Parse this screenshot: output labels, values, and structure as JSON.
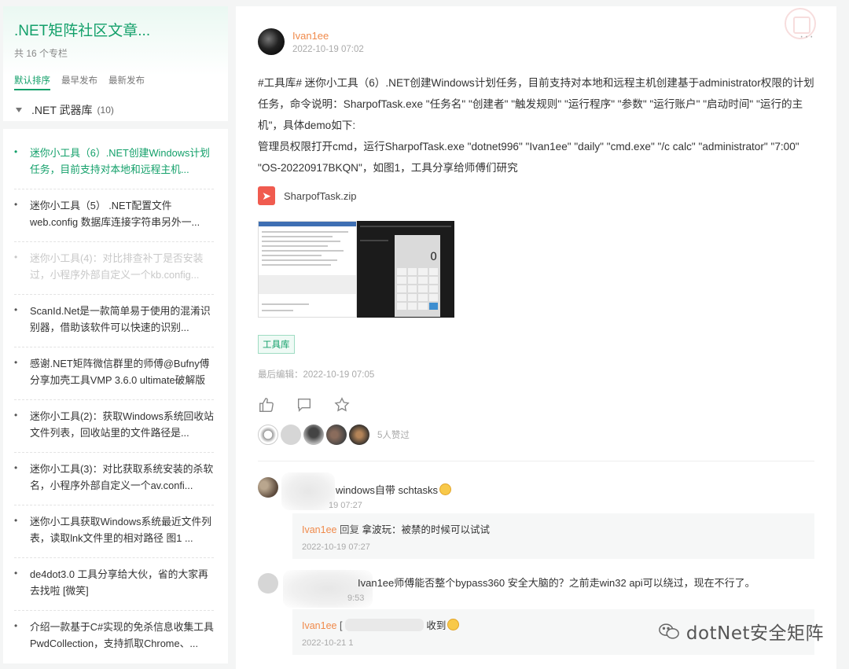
{
  "sidebar": {
    "title": ".NET矩阵社区文章...",
    "subtitle": "共 16 个专栏",
    "sort_tabs": [
      "默认排序",
      "最早发布",
      "最新发布"
    ],
    "category": {
      "label": ".NET 武器库",
      "count": "(10)"
    },
    "articles": [
      {
        "text": "迷你小工具（6）.NET创建Windows计划任务，目前支持对本地和远程主机...",
        "state": "active"
      },
      {
        "text": "迷你小工具（5） .NET配置文件web.config 数据库连接字符串另外一...",
        "state": "normal"
      },
      {
        "text": "迷你小工具(4)：对比排查补丁是否安装过，小程序外部自定义一个kb.config...",
        "state": "faded"
      },
      {
        "text": "ScanId.Net是一款简单易于使用的混淆识别器，借助该软件可以快速的识别...",
        "state": "normal"
      },
      {
        "text": "感谢.NET矩阵微信群里的师傅@Bufny傅分享加壳工具VMP 3.6.0 ultimate破解版",
        "state": "normal"
      },
      {
        "text": "迷你小工具(2)：获取Windows系统回收站文件列表，回收站里的文件路径是...",
        "state": "normal"
      },
      {
        "text": "迷你小工具(3)：对比获取系统安装的杀软名，小程序外部自定义一个av.confi...",
        "state": "normal"
      },
      {
        "text": "迷你小工具获取Windows系统最近文件列表，读取lnk文件里的相对路径 图1 ...",
        "state": "normal"
      },
      {
        "text": "de4dot3.0 工具分享给大伙，省的大家再去找啦 [微笑]",
        "state": "normal"
      },
      {
        "text": "介绍一款基于C#实现的免杀信息收集工具PwdCollection，支持抓取Chrome、...",
        "state": "normal"
      }
    ]
  },
  "post": {
    "author": "Ivan1ee",
    "time": "2022-10-19 07:02",
    "body_line1": "#工具库# 迷你小工具（6）.NET创建Windows计划任务，目前支持对本地和远程主机创建基于administrator权限的计划任务，命令说明：SharpofTask.exe \"任务名\" \"创建者\" \"触发规则\" \"运行程序\" \"参数\" \"运行账户\" \"启动时间\" \"运行的主机\"，具体demo如下:",
    "body_line2": "管理员权限打开cmd，运行SharpofTask.exe \"dotnet996\" \"Ivan1ee\" \"daily\" \"cmd.exe\" \"/c calc\" \"administrator\" \"7:00\" \"OS-20220917BKQN\"，如图1，工具分享给师傅们研究",
    "attachment": "SharpofTask.zip",
    "calc_display": "0",
    "tag": "工具库",
    "edited": "最后编辑：2022-10-19 07:05",
    "likes_text": "5人赞过"
  },
  "comments": [
    {
      "text": "windows自带 schtasks",
      "time": "19 07:27",
      "reply": {
        "name": "Ivan1ee",
        "verb": "回复",
        "target": "拿波玩",
        "text": "：被禁的时候可以试试",
        "time": "2022-10-19 07:27"
      }
    },
    {
      "text": "Ivan1ee师傅能否整个bypass360 安全大脑的？之前走win32 api可以绕过，现在不行了。",
      "time": "9:53",
      "reply": {
        "name": "Ivan1ee",
        "prefix": "[",
        "text": "收到",
        "time": "2022-10-21 1"
      }
    }
  ],
  "watermark": "dotNet安全矩阵",
  "colors": {
    "accent": "#13a06a",
    "author": "#f08a4b",
    "pdf": "#f05b4f"
  }
}
